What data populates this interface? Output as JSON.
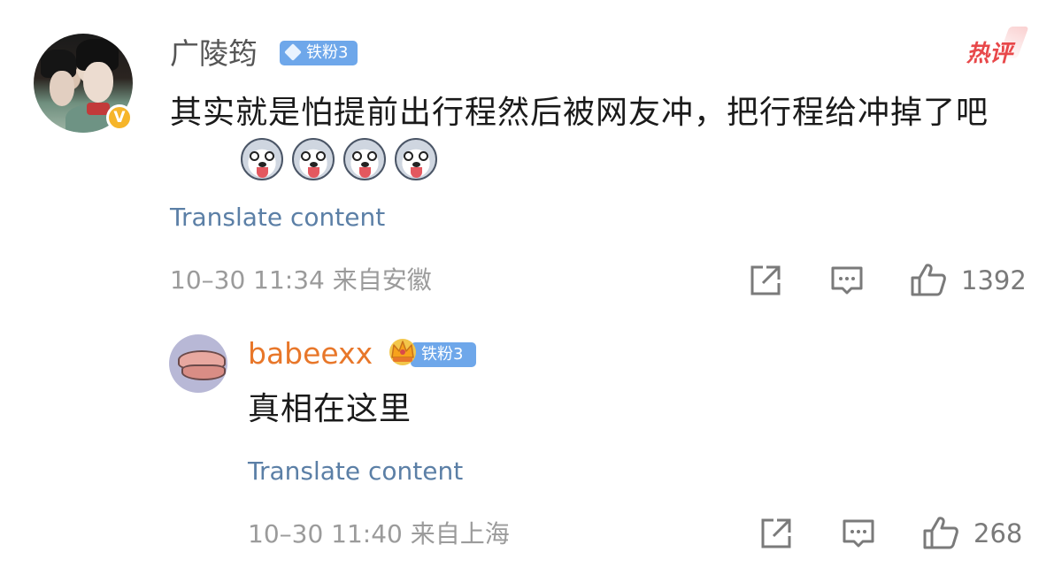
{
  "comment": {
    "username": "广陵筠",
    "verified_badge": "V",
    "fan_badge": "铁粉3",
    "hot_label": "热评",
    "text": "其实就是怕提前出行程然后被网友冲，把行程给冲掉了吧",
    "emoji_count": 4,
    "translate_label": "Translate content",
    "meta": "10–30 11:34 来自安徽",
    "actions": {
      "share_icon": "share-icon",
      "comment_icon": "comment-icon",
      "like_icon": "like-icon",
      "like_count": "1392"
    }
  },
  "reply": {
    "username": "babeexx",
    "fan_badge": "铁粉3",
    "text": "真相在这里",
    "translate_label": "Translate content",
    "meta": "10–30 11:40 来自上海",
    "actions": {
      "share_icon": "share-icon",
      "comment_icon": "comment-icon",
      "like_icon": "like-icon",
      "like_count": "268"
    }
  },
  "colors": {
    "username_gray": "#555555",
    "reply_username_orange": "#e8772a",
    "link_blue": "#5b7fa6",
    "fan_badge_blue": "#6ea7ea",
    "hot_red": "#e8484a",
    "verify_gold": "#f6b52a"
  }
}
